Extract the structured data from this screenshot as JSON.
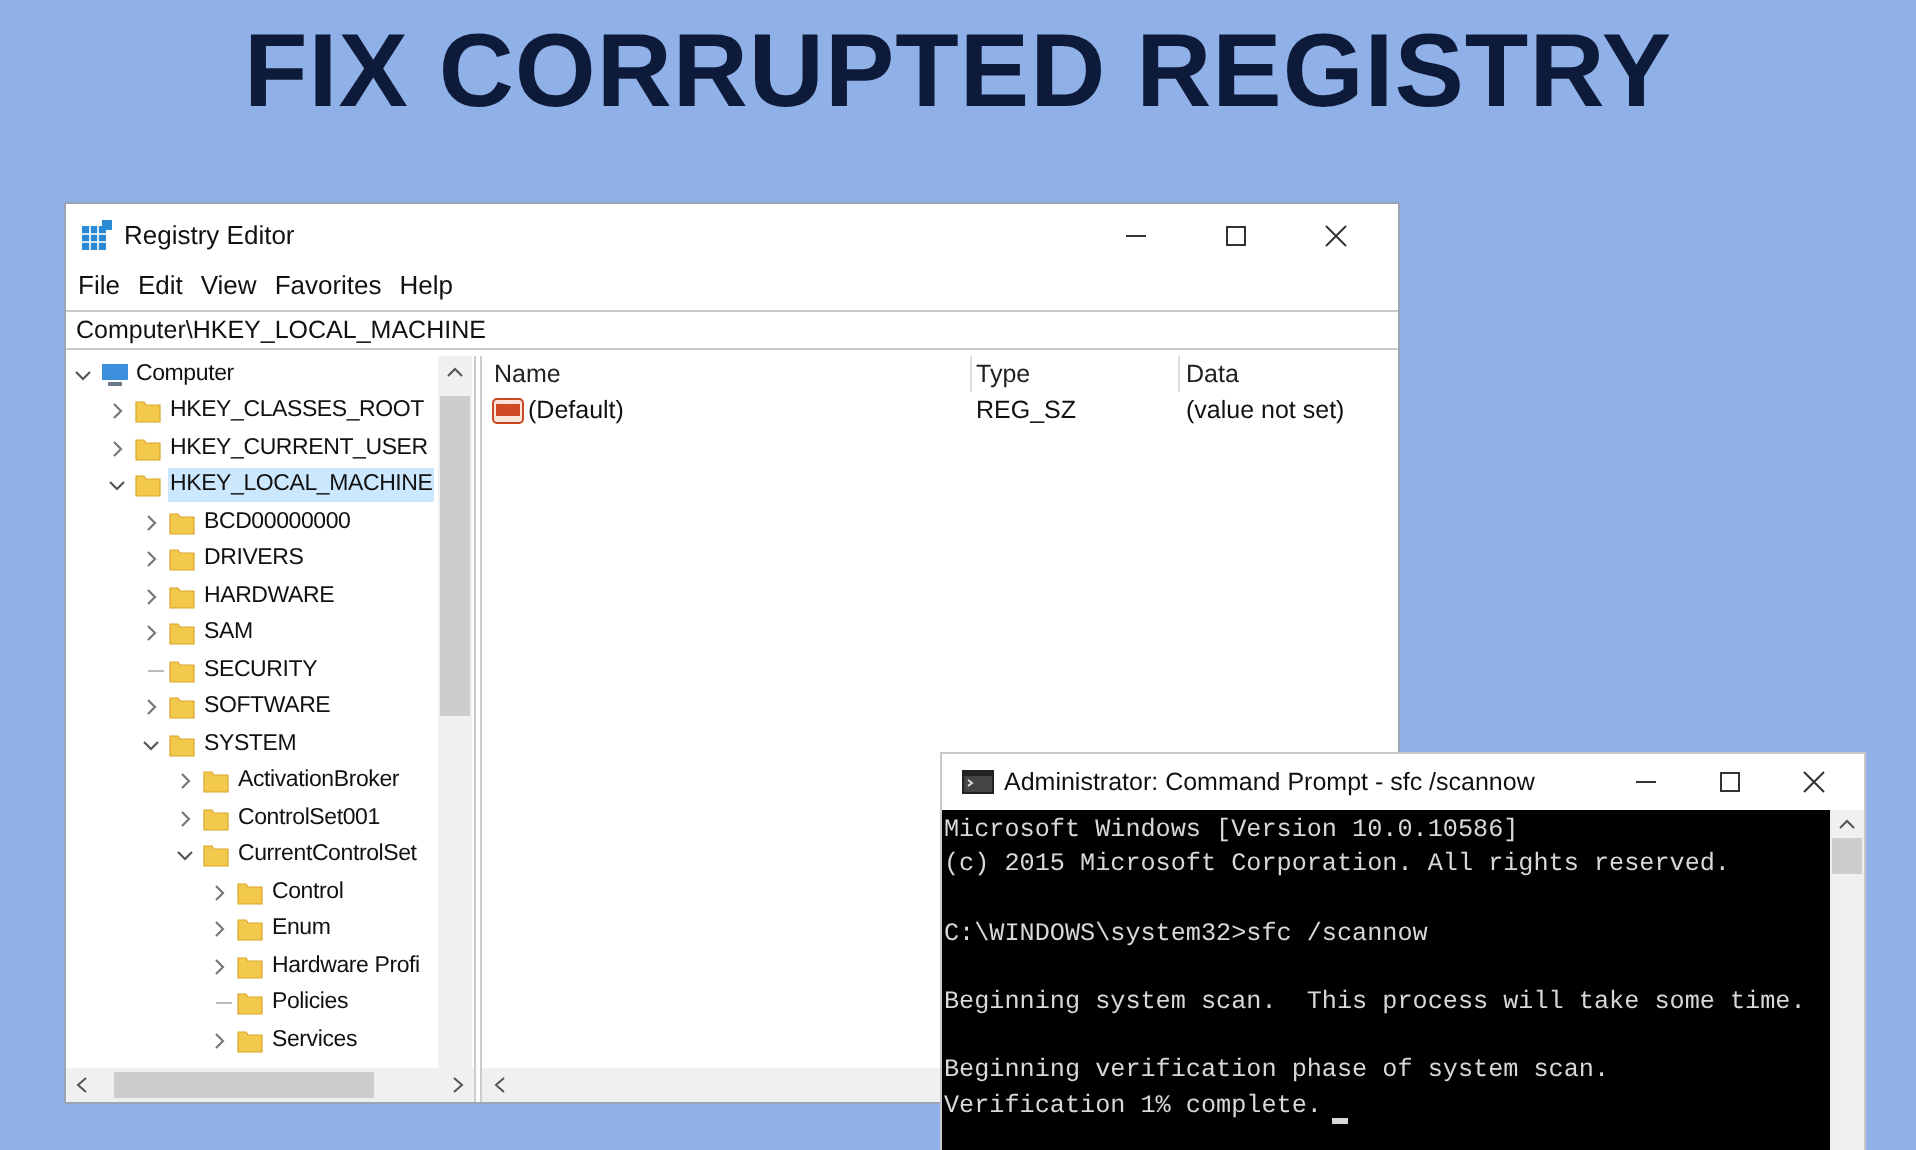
{
  "headline": "FIX CORRUPTED REGISTRY",
  "registry_window": {
    "title": "Registry Editor",
    "menu": [
      "File",
      "Edit",
      "View",
      "Favorites",
      "Help"
    ],
    "address": "Computer\\HKEY_LOCAL_MACHINE",
    "tree": [
      {
        "label": "Computer",
        "kind": "computer",
        "expanded": true,
        "selected": false,
        "has_children": true,
        "children": [
          {
            "label": "HKEY_CLASSES_ROOT",
            "kind": "folder",
            "expanded": false,
            "selected": false,
            "has_children": true
          },
          {
            "label": "HKEY_CURRENT_USER",
            "kind": "folder",
            "expanded": false,
            "selected": false,
            "has_children": true
          },
          {
            "label": "HKEY_LOCAL_MACHINE",
            "kind": "folder",
            "expanded": true,
            "selected": true,
            "has_children": true,
            "children": [
              {
                "label": "BCD00000000",
                "kind": "folder",
                "expanded": false,
                "selected": false,
                "has_children": true
              },
              {
                "label": "DRIVERS",
                "kind": "folder",
                "expanded": false,
                "selected": false,
                "has_children": true
              },
              {
                "label": "HARDWARE",
                "kind": "folder",
                "expanded": false,
                "selected": false,
                "has_children": true
              },
              {
                "label": "SAM",
                "kind": "folder",
                "expanded": false,
                "selected": false,
                "has_children": true
              },
              {
                "label": "SECURITY",
                "kind": "folder",
                "expanded": false,
                "selected": false,
                "has_children": false
              },
              {
                "label": "SOFTWARE",
                "kind": "folder",
                "expanded": false,
                "selected": false,
                "has_children": true
              },
              {
                "label": "SYSTEM",
                "kind": "folder",
                "expanded": true,
                "selected": false,
                "has_children": true,
                "children": [
                  {
                    "label": "ActivationBroker",
                    "kind": "folder",
                    "expanded": false,
                    "selected": false,
                    "has_children": true
                  },
                  {
                    "label": "ControlSet001",
                    "kind": "folder",
                    "expanded": false,
                    "selected": false,
                    "has_children": true
                  },
                  {
                    "label": "CurrentControlSet",
                    "kind": "folder",
                    "expanded": true,
                    "selected": false,
                    "has_children": true,
                    "children": [
                      {
                        "label": "Control",
                        "kind": "folder",
                        "expanded": false,
                        "selected": false,
                        "has_children": true
                      },
                      {
                        "label": "Enum",
                        "kind": "folder",
                        "expanded": false,
                        "selected": false,
                        "has_children": true
                      },
                      {
                        "label": "Hardware Profi",
                        "kind": "folder",
                        "expanded": false,
                        "selected": false,
                        "has_children": true
                      },
                      {
                        "label": "Policies",
                        "kind": "folder",
                        "expanded": false,
                        "selected": false,
                        "has_children": false
                      },
                      {
                        "label": "Services",
                        "kind": "folder",
                        "expanded": false,
                        "selected": false,
                        "has_children": true
                      }
                    ]
                  }
                ]
              }
            ]
          }
        ]
      }
    ],
    "columns": [
      "Name",
      "Type",
      "Data"
    ],
    "values": [
      {
        "name": "(Default)",
        "type": "REG_SZ",
        "data": "(value not set)"
      }
    ]
  },
  "cmd_window": {
    "title": "Administrator: Command Prompt - sfc  /scannow",
    "cursor": true,
    "paragraphs": [
      [
        "Microsoft Windows [Version 10.0.10586]",
        "(c) 2015 Microsoft Corporation. All rights reserved."
      ],
      [
        "C:\\WINDOWS\\system32>sfc /scannow"
      ],
      [
        "Beginning system scan.  This process will take some time."
      ],
      [
        "Beginning verification phase of system scan.",
        "Verification 1% complete."
      ]
    ]
  }
}
